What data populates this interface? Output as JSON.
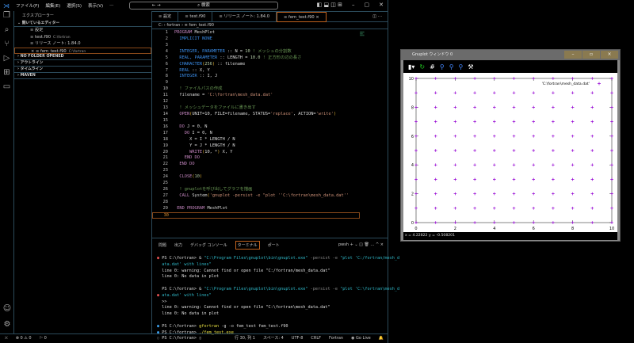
{
  "title": {
    "menus": [
      "ファイル(F)",
      "編集(E)",
      "選択(S)",
      "表示(V)",
      "…"
    ],
    "search": "⌕ 検索"
  },
  "sidebar": {
    "header": "エクスプローラー",
    "open_editors": "開いているエディター",
    "files": [
      {
        "name": "設定",
        "path": ""
      },
      {
        "name": "test.f90",
        "path": "C:\\fortran"
      },
      {
        "name": "リリース ノート: 1.84.0",
        "path": ""
      },
      {
        "name": "fem_test.f90",
        "path": "C:\\fortran"
      }
    ],
    "sections": [
      "NO FOLDER OPENED",
      "アウトライン",
      "タイムライン",
      "MAVEN"
    ]
  },
  "tabs": [
    "≡ 設定",
    "≡ test.f90",
    "≡ リリース ノート: 1.84.0",
    "≡ fem_test.f90 ×"
  ],
  "breadcrumb": "C: › fortran › ≡ fem_test.f90",
  "code": [
    [
      [
        "PROGRAM ",
        "p"
      ],
      [
        "MeshPlot",
        "v"
      ]
    ],
    [
      [
        "  IMPLICIT NONE",
        "k"
      ]
    ],
    [],
    [
      [
        "  INTEGER, PARAMETER",
        "k"
      ],
      [
        " :: N = ",
        "v"
      ],
      [
        "10",
        "n"
      ],
      [
        " ! メッシュの分割数",
        "c"
      ]
    ],
    [
      [
        "  REAL, PARAMETER",
        "k"
      ],
      [
        " :: LENGTH = ",
        "v"
      ],
      [
        "10.0",
        "n"
      ],
      [
        " ! 正方形の辺の長さ",
        "c"
      ]
    ],
    [
      [
        "  CHARACTER",
        "k"
      ],
      [
        "(",
        "b"
      ],
      [
        "256",
        "n"
      ],
      [
        ")",
        "b"
      ],
      [
        " :: filename",
        "v"
      ]
    ],
    [
      [
        "  REAL",
        "k"
      ],
      [
        " :: X, Y",
        "v"
      ]
    ],
    [
      [
        "  INTEGER",
        "k"
      ],
      [
        " :: I, J",
        "v"
      ]
    ],
    [],
    [
      [
        "  ! ファイルパスの作成",
        "c"
      ]
    ],
    [
      [
        "  filename = ",
        "v"
      ],
      [
        "'C:\\fortran\\mesh_data.dat'",
        "s"
      ]
    ],
    [],
    [
      [
        "  ! メッシュデータをファイルに書き出す",
        "c"
      ]
    ],
    [
      [
        "  OPEN",
        "p"
      ],
      [
        "(",
        "b"
      ],
      [
        "UNIT=10, FILE=filename, STATUS=",
        "v"
      ],
      [
        "'replace'",
        "s"
      ],
      [
        ", ACTION=",
        "v"
      ],
      [
        "'write'",
        "s"
      ],
      [
        ")",
        "b"
      ]
    ],
    [],
    [
      [
        "  DO ",
        "p"
      ],
      [
        "J = 0, N",
        "v"
      ]
    ],
    [
      [
        "    DO ",
        "p"
      ],
      [
        "I = 0, N",
        "v"
      ]
    ],
    [
      [
        "      X = I * LENGTH / N",
        "v"
      ]
    ],
    [
      [
        "      Y = J * LENGTH / N",
        "v"
      ]
    ],
    [
      [
        "      WRITE",
        "p"
      ],
      [
        "(",
        "b"
      ],
      [
        "10, *",
        "v"
      ],
      [
        ")",
        "b"
      ],
      [
        " X, Y",
        "v"
      ]
    ],
    [
      [
        "    END DO",
        "p"
      ]
    ],
    [
      [
        "  END DO",
        "p"
      ]
    ],
    [],
    [
      [
        "  CLOSE",
        "p"
      ],
      [
        "(",
        "b"
      ],
      [
        "10",
        "n"
      ],
      [
        ")",
        "b"
      ]
    ],
    [],
    [
      [
        "  ! gnuplotを呼び出してグラフを描画",
        "c"
      ]
    ],
    [
      [
        "  CALL ",
        "p"
      ],
      [
        "System",
        "v"
      ],
      [
        "(",
        "b"
      ],
      [
        "'gnuplot -persist -e \"plot ''C:\\fortran\\mesh_data.dat''",
        "s"
      ]
    ],
    [],
    [
      [
        " END PROGRAM ",
        "p"
      ],
      [
        "MeshPlot",
        "v"
      ]
    ],
    []
  ],
  "panel": {
    "tabs": [
      "問題",
      "出力",
      "デバッグ コンソール",
      "ターミナル",
      "ポート"
    ],
    "shell": "pwsh  +  ⌄  ◫  🗑  …  ^  ×",
    "terminal": [
      [
        [
          "● ",
          "tr"
        ],
        [
          "PS C:\\fortran> & ",
          ""
        ],
        [
          "\"C:\\Program Files\\gnuplot\\bin\\gnuplot.exe\"",
          "tq"
        ],
        [
          " -persist -e ",
          "tg"
        ],
        [
          "\"plot 'C:/fortran/mesh_d",
          "tq"
        ]
      ],
      [
        [
          "  ata.dat' with lines\"",
          "tq"
        ]
      ],
      [
        [
          "  line 0: warning: Cannot find or open file \"C:/fortran/mesh_data.dat\"",
          ""
        ]
      ],
      [
        [
          "  line 0: No data in plot",
          ""
        ]
      ],
      [],
      [
        [
          "  PS C:\\fortran> & ",
          ""
        ],
        [
          "\"C:\\Program Files\\gnuplot\\bin\\gnuplot.exe\"",
          "tq"
        ],
        [
          " -persist -e ",
          "tg"
        ],
        [
          "\"plot 'C:\\fortran\\mesh_d",
          "tq"
        ]
      ],
      [
        [
          "● ",
          "tr"
        ],
        [
          "ata.dat' with lines\"",
          "tq"
        ]
      ],
      [
        [
          "  >>",
          ""
        ]
      ],
      [
        [
          "  line 0: warning: Cannot find or open file \"C:\\fortran\\mesh_data.dat\"",
          ""
        ]
      ],
      [
        [
          "  line 0: No data in plot",
          ""
        ]
      ],
      [],
      [
        [
          "● ",
          "tb2"
        ],
        [
          "PS C:\\fortran> ",
          ""
        ],
        [
          "gfortran",
          "ty"
        ],
        [
          " -g -o fem_test fem_test.f90",
          ""
        ]
      ],
      [
        [
          "● ",
          "tb2"
        ],
        [
          "PS C:\\fortran> ",
          ""
        ],
        [
          "./fem_test.exe",
          "ty"
        ]
      ],
      [
        [
          "○ ",
          "tg"
        ],
        [
          "PS C:\\fortran> ▯",
          ""
        ]
      ]
    ]
  },
  "status": {
    "left": [
      "⛌",
      "⊗ 0 ⚠ 0",
      "⚐ 0"
    ],
    "right": [
      "行 30, 列 1",
      "スペース: 4",
      "UTF-8",
      "CRLF",
      "Fortran",
      "◉ Go Live",
      "🔔"
    ]
  },
  "gnuplot": {
    "title": "Gnuplot ウィンドウ 0",
    "status": "x = 4.22822 y = -0.508201",
    "chart_data": {
      "type": "scatter",
      "title": "",
      "legend": "'C:\\fortran\\mesh_data.dat'",
      "legend_placement": "top-right",
      "xlim": [
        0,
        10
      ],
      "ylim": [
        0,
        10
      ],
      "xticks": [
        "0",
        "2",
        "4",
        "6",
        "8",
        "10"
      ],
      "yticks": [
        "0",
        "2",
        "4",
        "6",
        "8",
        "10"
      ],
      "points": "grid x=0..10, y=0..10 step 1",
      "grid_n": 10,
      "length": 10,
      "color": "#9400d3"
    }
  }
}
